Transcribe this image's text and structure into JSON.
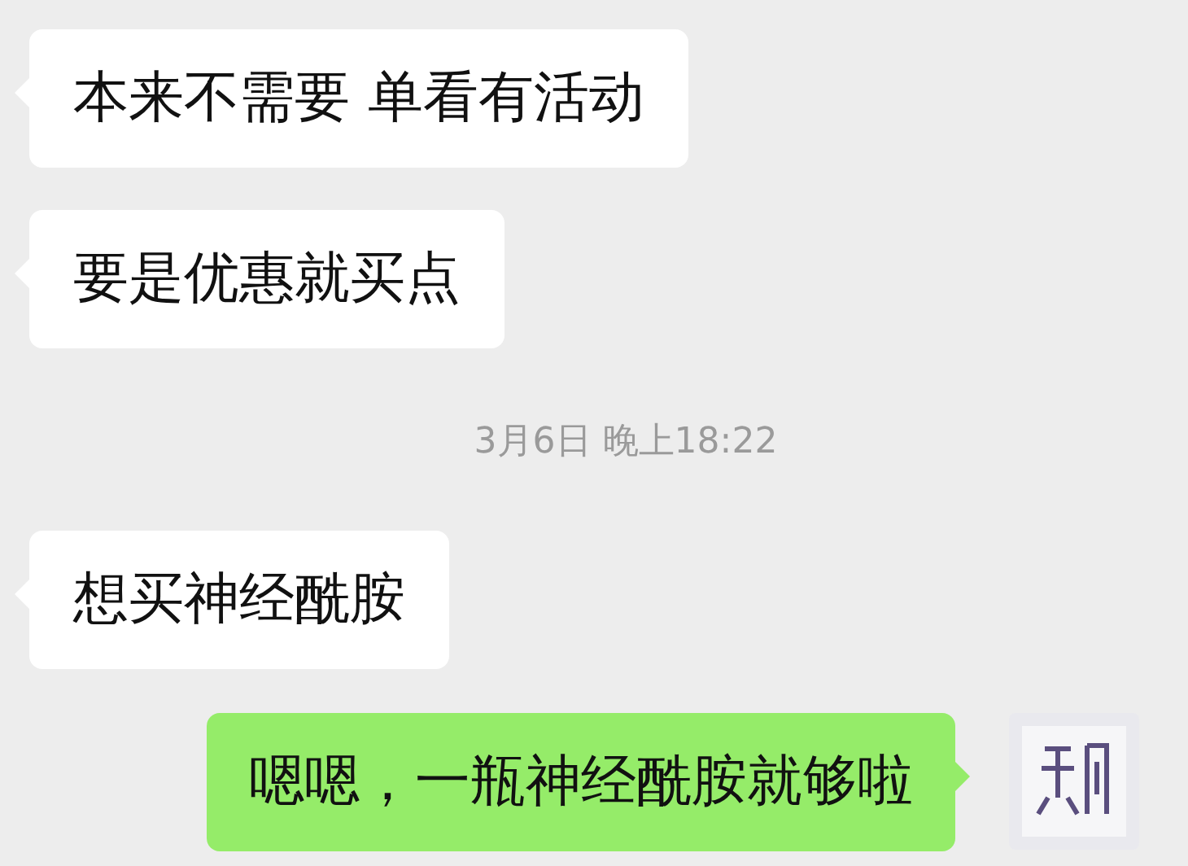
{
  "messages": [
    {
      "kind": "received",
      "text": "本来不需要 单看有活动"
    },
    {
      "kind": "received",
      "text": "要是优惠就买点"
    },
    {
      "kind": "time",
      "text": "3月6日 晚上18:22"
    },
    {
      "kind": "received",
      "text": "想买神经酰胺"
    },
    {
      "kind": "sent",
      "text": "嗯嗯，一瓶神经酰胺就够啦"
    }
  ]
}
